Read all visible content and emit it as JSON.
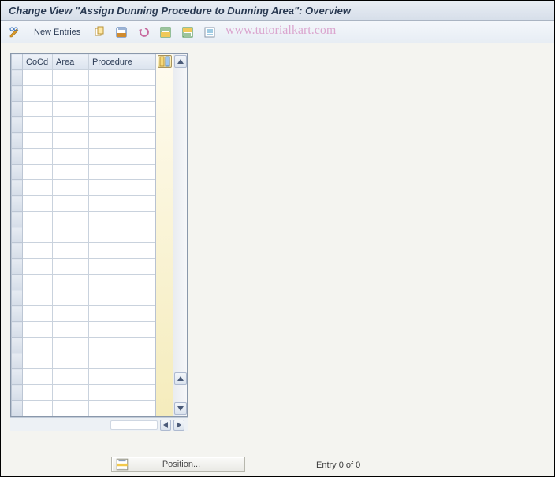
{
  "title": "Change View \"Assign Dunning Procedure to Dunning Area\": Overview",
  "toolbar": {
    "new_entries": "New Entries"
  },
  "watermark": "www.tutorialkart.com",
  "table": {
    "headers": {
      "cocd": "CoCd",
      "area": "Area",
      "procedure": "Procedure"
    },
    "rows": [
      {
        "cocd": "",
        "area": "",
        "procedure": ""
      },
      {
        "cocd": "",
        "area": "",
        "procedure": ""
      },
      {
        "cocd": "",
        "area": "",
        "procedure": ""
      },
      {
        "cocd": "",
        "area": "",
        "procedure": ""
      },
      {
        "cocd": "",
        "area": "",
        "procedure": ""
      },
      {
        "cocd": "",
        "area": "",
        "procedure": ""
      },
      {
        "cocd": "",
        "area": "",
        "procedure": ""
      },
      {
        "cocd": "",
        "area": "",
        "procedure": ""
      },
      {
        "cocd": "",
        "area": "",
        "procedure": ""
      },
      {
        "cocd": "",
        "area": "",
        "procedure": ""
      },
      {
        "cocd": "",
        "area": "",
        "procedure": ""
      },
      {
        "cocd": "",
        "area": "",
        "procedure": ""
      },
      {
        "cocd": "",
        "area": "",
        "procedure": ""
      },
      {
        "cocd": "",
        "area": "",
        "procedure": ""
      },
      {
        "cocd": "",
        "area": "",
        "procedure": ""
      },
      {
        "cocd": "",
        "area": "",
        "procedure": ""
      },
      {
        "cocd": "",
        "area": "",
        "procedure": ""
      },
      {
        "cocd": "",
        "area": "",
        "procedure": ""
      },
      {
        "cocd": "",
        "area": "",
        "procedure": ""
      },
      {
        "cocd": "",
        "area": "",
        "procedure": ""
      },
      {
        "cocd": "",
        "area": "",
        "procedure": ""
      },
      {
        "cocd": "",
        "area": "",
        "procedure": ""
      }
    ]
  },
  "footer": {
    "position_label": "Position...",
    "entry_text": "Entry 0 of 0"
  }
}
